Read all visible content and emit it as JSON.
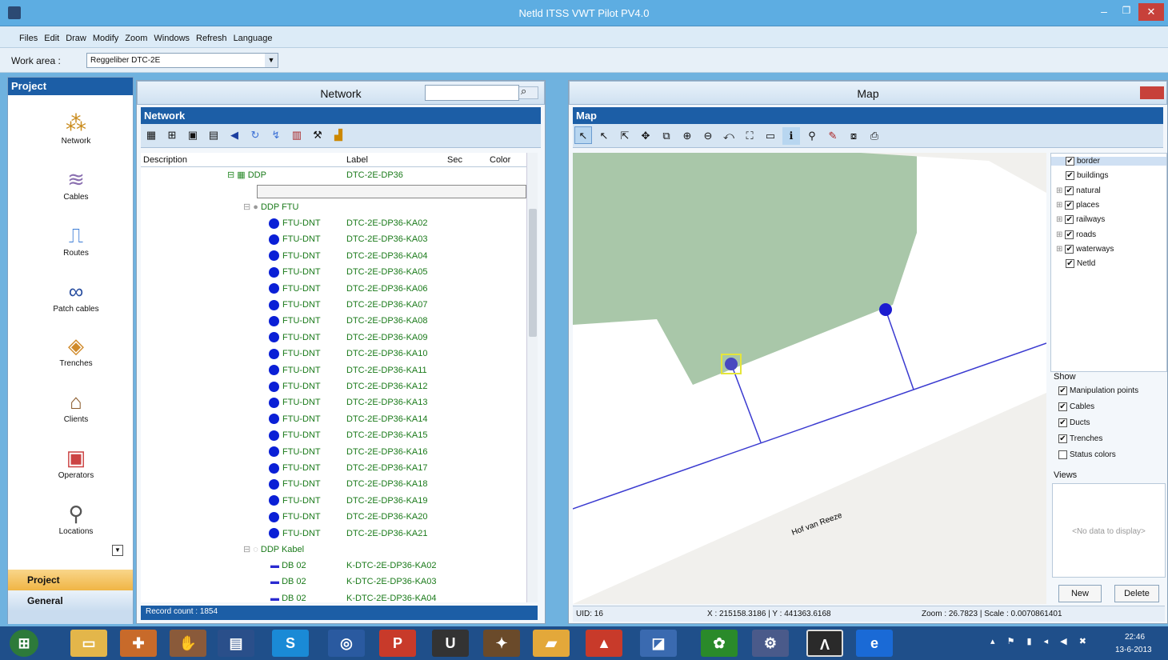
{
  "app": {
    "title": "Netld ITSS VWT Pilot PV4.0"
  },
  "menu": [
    "Files",
    "Edit",
    "Draw",
    "Modify",
    "Zoom",
    "Windows",
    "Refresh",
    "Language"
  ],
  "workarea": {
    "label": "Work area :",
    "value": "Reggeliber DTC-2E"
  },
  "sidebar": {
    "header": "Project",
    "items": [
      "Network",
      "Cables",
      "Routes",
      "Patch cables",
      "Trenches",
      "Clients",
      "Operators",
      "Locations"
    ],
    "bottom_tabs": [
      "Project",
      "General"
    ]
  },
  "network": {
    "window_title": "Network",
    "header": "Network",
    "columns": [
      "Description",
      "Label",
      "Sec",
      "Color"
    ],
    "ddp": {
      "desc": "DDP",
      "label": "DTC-2E-DP36"
    },
    "ftu_group": "DDP FTU",
    "ftu_rows": [
      [
        "FTU-DNT",
        "DTC-2E-DP36-KA02"
      ],
      [
        "FTU-DNT",
        "DTC-2E-DP36-KA03"
      ],
      [
        "FTU-DNT",
        "DTC-2E-DP36-KA04"
      ],
      [
        "FTU-DNT",
        "DTC-2E-DP36-KA05"
      ],
      [
        "FTU-DNT",
        "DTC-2E-DP36-KA06"
      ],
      [
        "FTU-DNT",
        "DTC-2E-DP36-KA07"
      ],
      [
        "FTU-DNT",
        "DTC-2E-DP36-KA08"
      ],
      [
        "FTU-DNT",
        "DTC-2E-DP36-KA09"
      ],
      [
        "FTU-DNT",
        "DTC-2E-DP36-KA10"
      ],
      [
        "FTU-DNT",
        "DTC-2E-DP36-KA11"
      ],
      [
        "FTU-DNT",
        "DTC-2E-DP36-KA12"
      ],
      [
        "FTU-DNT",
        "DTC-2E-DP36-KA13"
      ],
      [
        "FTU-DNT",
        "DTC-2E-DP36-KA14"
      ],
      [
        "FTU-DNT",
        "DTC-2E-DP36-KA15"
      ],
      [
        "FTU-DNT",
        "DTC-2E-DP36-KA16"
      ],
      [
        "FTU-DNT",
        "DTC-2E-DP36-KA17"
      ],
      [
        "FTU-DNT",
        "DTC-2E-DP36-KA18"
      ],
      [
        "FTU-DNT",
        "DTC-2E-DP36-KA19"
      ],
      [
        "FTU-DNT",
        "DTC-2E-DP36-KA20"
      ],
      [
        "FTU-DNT",
        "DTC-2E-DP36-KA21"
      ]
    ],
    "kabel_group": "DDP Kabel",
    "kabel_rows": [
      [
        "DB 02",
        "K-DTC-2E-DP36-KA02"
      ],
      [
        "DB 02",
        "K-DTC-2E-DP36-KA03"
      ],
      [
        "DB 02",
        "K-DTC-2E-DP36-KA04"
      ]
    ],
    "record_count": "Record count : 1854"
  },
  "map": {
    "window_title": "Map",
    "header": "Map",
    "street_label": "Hof van Reeze",
    "layers": [
      "border",
      "buildings",
      "natural",
      "places",
      "railways",
      "roads",
      "waterways",
      "Netld"
    ],
    "show_label": "Show",
    "show_items": [
      {
        "label": "Manipulation points",
        "checked": true
      },
      {
        "label": "Cables",
        "checked": true
      },
      {
        "label": "Ducts",
        "checked": true
      },
      {
        "label": "Trenches",
        "checked": true
      },
      {
        "label": "Status colors",
        "checked": false
      }
    ],
    "views_label": "Views",
    "no_data": "<No data to display>",
    "new_btn": "New",
    "delete_btn": "Delete",
    "status_uid": "UID: 16",
    "status_xy": "X : 215158.3186 | Y : 441363.6168",
    "status_zoom": "Zoom : 26.7823 | Scale : 0.0070861401"
  },
  "taskbar": {
    "time": "22:46",
    "date": "13-6-2013"
  }
}
